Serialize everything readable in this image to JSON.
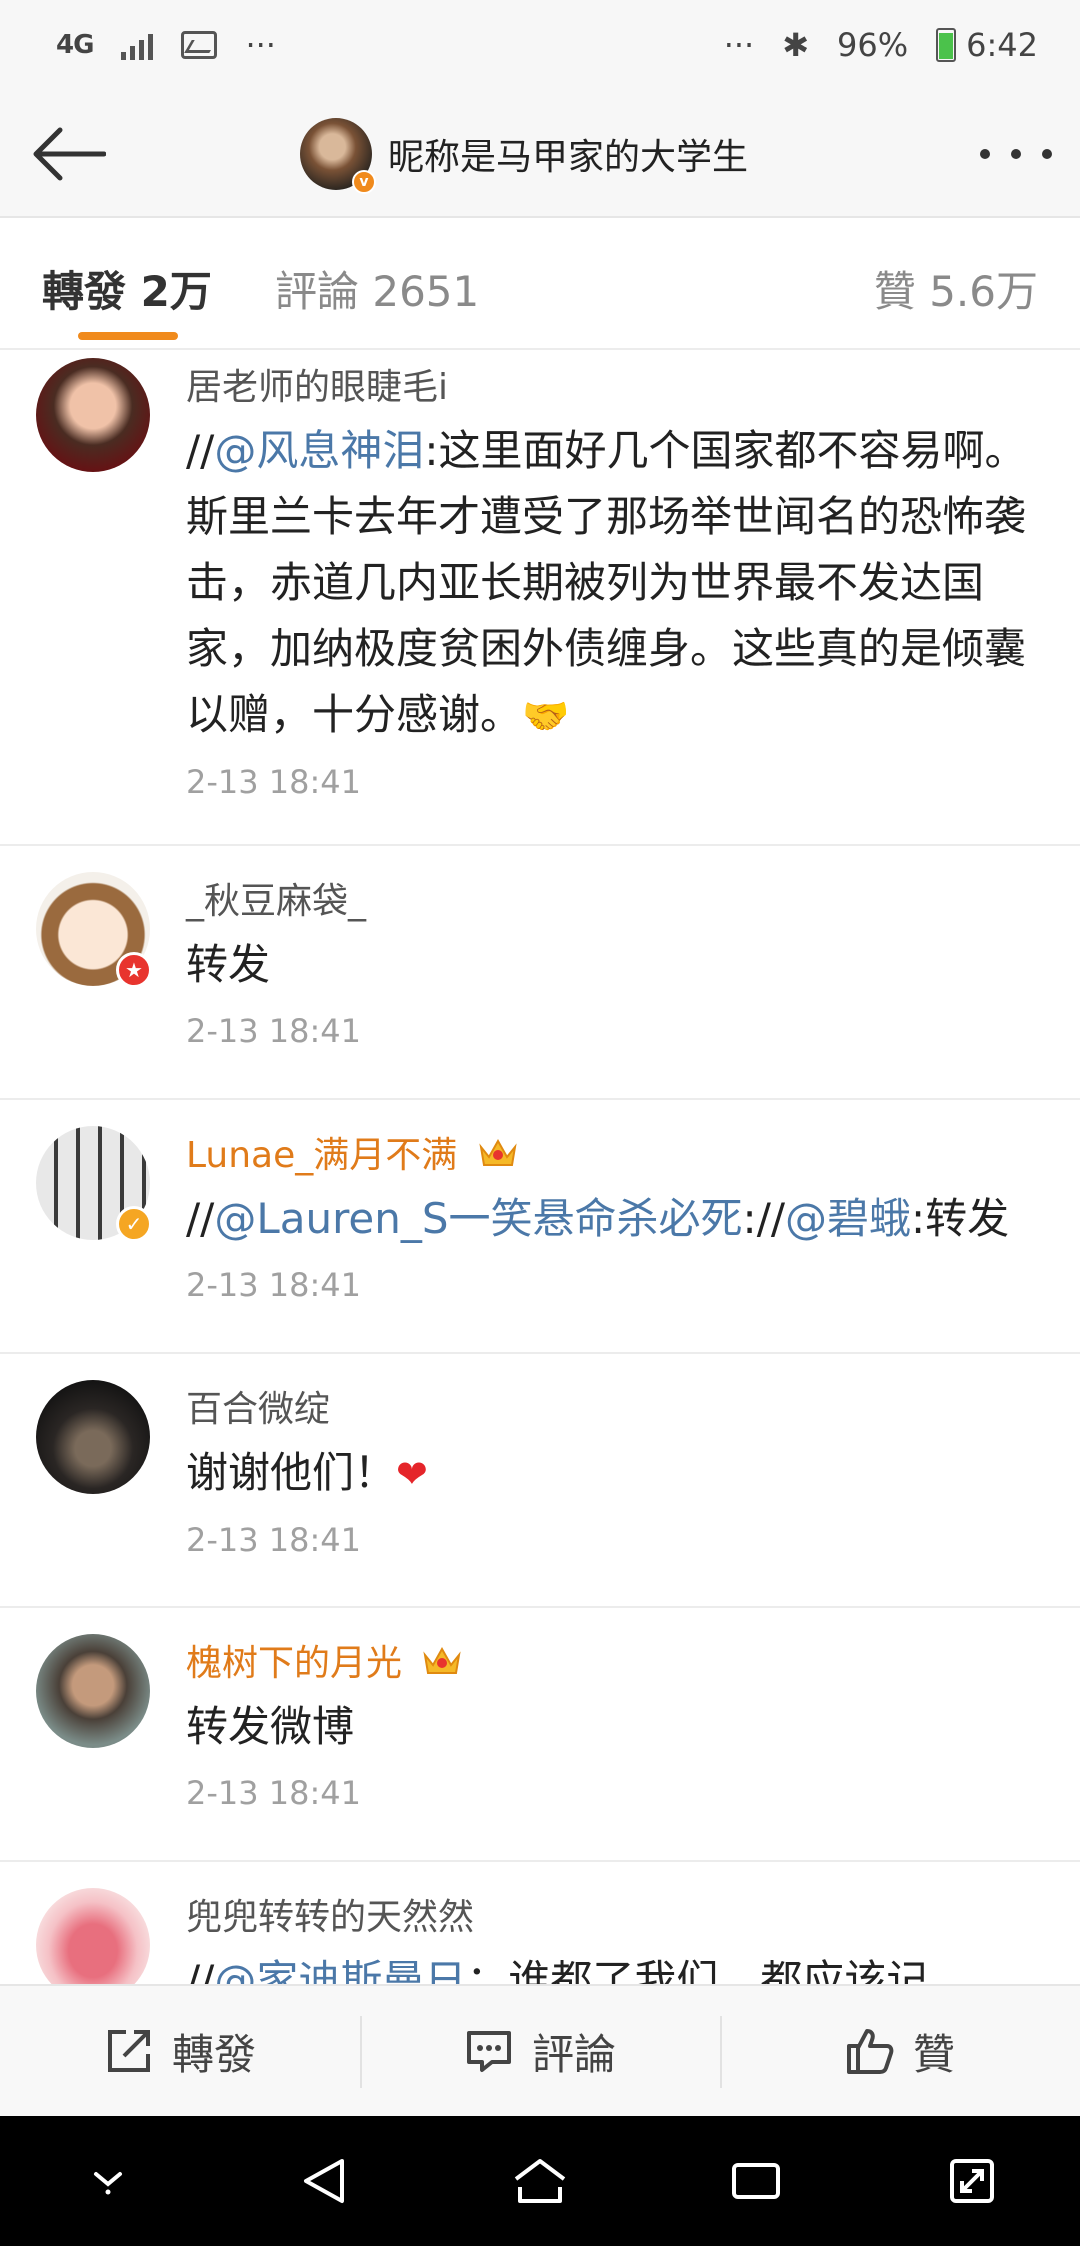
{
  "status_bar": {
    "network": "4G",
    "more_left": "···",
    "more_right": "···",
    "battery": "96%",
    "time": "6:42"
  },
  "header": {
    "title": "昵称是马甲家的大学生"
  },
  "tabs": {
    "repost": "轉發 2万",
    "comment": "評論 2651",
    "like": "贊 5.6万"
  },
  "feed": [
    {
      "name": "居老师的眼睫毛i",
      "content_parts": [
        "//",
        "@风息神泪",
        ":这里面好几个国家都不容易啊。斯里兰卡去年才遭受了那场举世闻名的恐怖袭击，赤道几内亚长期被列为世界最不发达国家，加纳极度贫困外债缠身。这些真的是倾囊以赠，十分感谢。"
      ],
      "emoji": "🤝",
      "time": "2-13 18:41"
    },
    {
      "name": "_秋豆麻袋_",
      "content": "转发",
      "time": "2-13 18:41"
    },
    {
      "name": "Lunae_满月不满",
      "content_parts": [
        "//",
        "@Lauren_S一笑悬命杀必死",
        "://",
        "@碧蛾",
        ":转发"
      ],
      "time": "2-13 18:41"
    },
    {
      "name": "百合微绽",
      "content": "谢谢他们！",
      "emoji": "❤",
      "time": "2-13 18:41"
    },
    {
      "name": "槐树下的月光",
      "content": "转发微博",
      "time": "2-13 18:41"
    },
    {
      "name": "兜兜转转的天然然",
      "content_parts": [
        "//",
        "@家迪斯曼日",
        "：谁都了我们，都应该记"
      ]
    }
  ],
  "action_bar": {
    "repost": "轉發",
    "comment": "評論",
    "like": "贊"
  },
  "colors": {
    "accent": "#f08a1c",
    "mention": "#4b78a8",
    "vip_name": "#e07b1a"
  }
}
